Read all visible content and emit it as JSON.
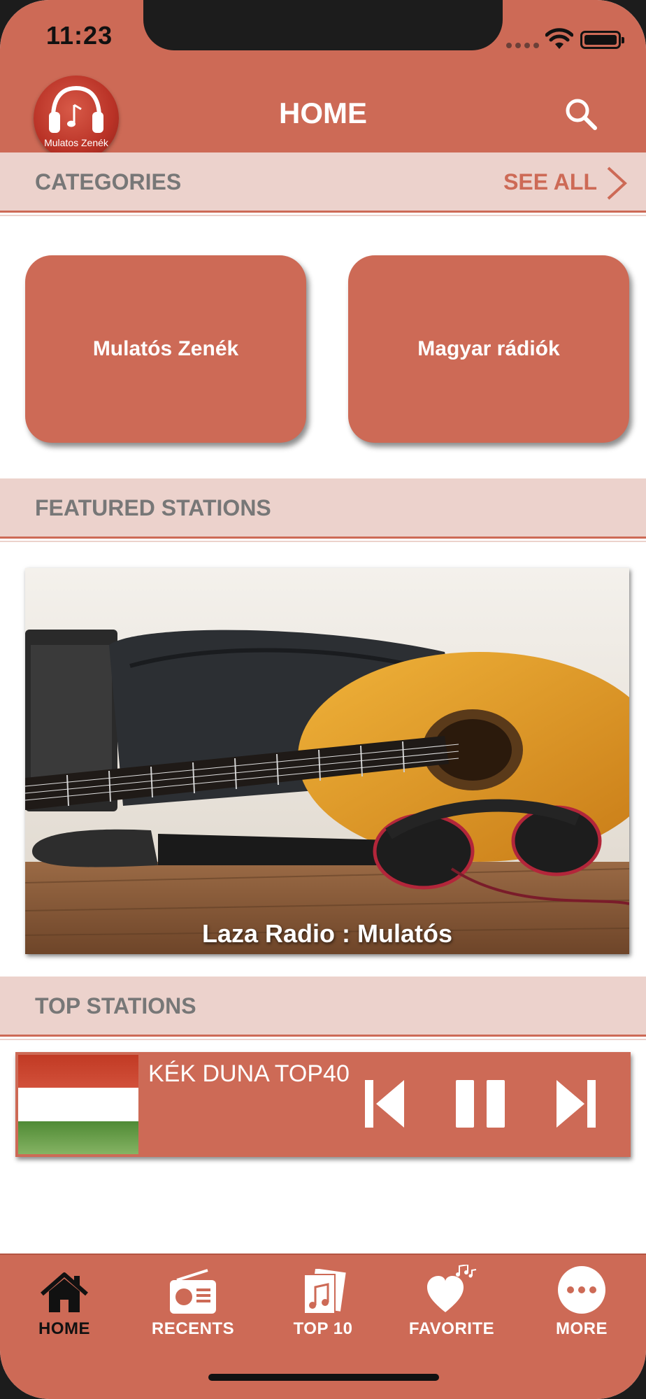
{
  "status_bar": {
    "time": "11:23"
  },
  "nav": {
    "title": "HOME",
    "logo_text": "Mulatos Zenék"
  },
  "categories": {
    "title": "CATEGORIES",
    "see_all": "SEE ALL",
    "items": [
      {
        "label": "Mulatós Zenék"
      },
      {
        "label": "Magyar rádiók"
      }
    ]
  },
  "featured": {
    "title": "FEATURED STATIONS",
    "station": "Laza Radio : Mulatós"
  },
  "top": {
    "title": "TOP STATIONS",
    "now_playing": "KÉK DUNA TOP40"
  },
  "tabs": [
    {
      "label": "HOME",
      "icon": "home-icon",
      "active": true
    },
    {
      "label": "RECENTS",
      "icon": "radio-icon",
      "active": false
    },
    {
      "label": "TOP 10",
      "icon": "music-note-icon",
      "active": false
    },
    {
      "label": "FAVORITE",
      "icon": "heart-icon",
      "active": false
    },
    {
      "label": "MORE",
      "icon": "more-icon",
      "active": false
    }
  ],
  "colors": {
    "accent": "#cd6a56",
    "header_bg": "#ecd2cc",
    "section_text": "#777777"
  }
}
